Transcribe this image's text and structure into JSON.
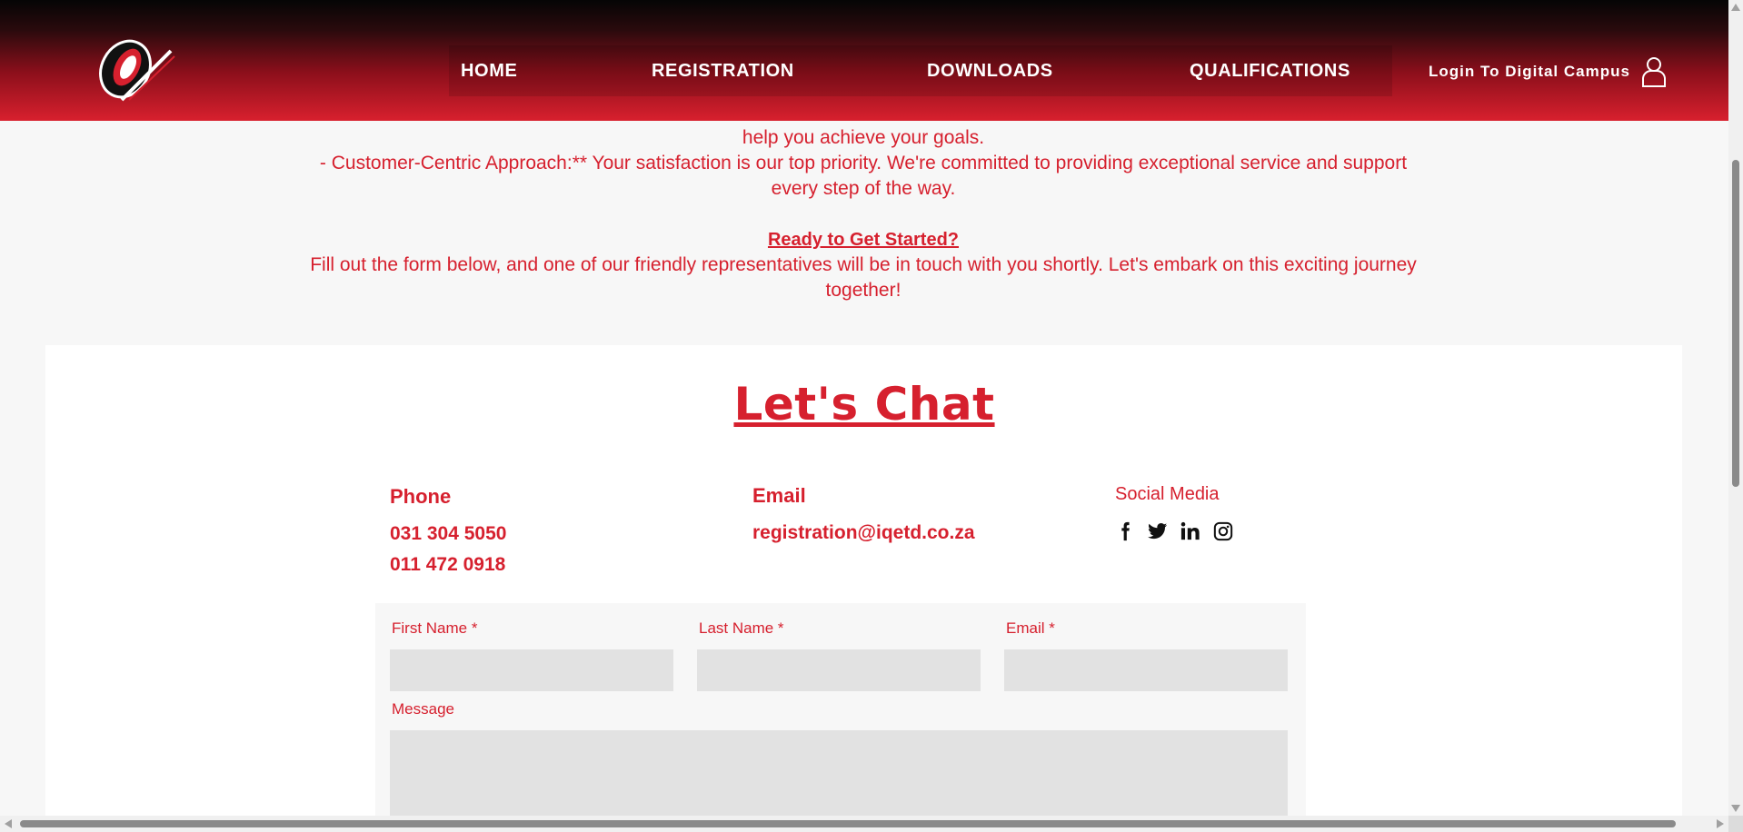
{
  "header": {
    "nav": [
      {
        "label": "HOME"
      },
      {
        "label": "REGISTRATION"
      },
      {
        "label": "DOWNLOADS"
      },
      {
        "label": "QUALIFICATIONS"
      }
    ],
    "login_label": "Login To Digital Campus"
  },
  "intro": {
    "partial_line": "help you achieve your goals.",
    "customer_line": "- Customer-Centric Approach:** Your satisfaction is our top priority. We're committed to providing exceptional service and support every step of the way.",
    "ready_heading": "Ready to Get Started?",
    "ready_text": "Fill out the form below, and one of our friendly representatives will be in touch with you shortly. Let's embark on this exciting journey together!"
  },
  "contact": {
    "title": "Let's Chat",
    "phone_label": "Phone",
    "phone_1": "031 304 5050",
    "phone_2": "011 472 0918",
    "email_label": "Email",
    "email_value": "registration@iqetd.co.za",
    "social_label": "Social Media",
    "social_icons": [
      "facebook-icon",
      "twitter-icon",
      "linkedin-icon",
      "instagram-icon"
    ]
  },
  "form": {
    "first_name_label": "First Name *",
    "last_name_label": "Last Name *",
    "email_label": "Email *",
    "message_label": "Message",
    "first_name_value": "",
    "last_name_value": "",
    "email_value": "",
    "message_value": ""
  },
  "colors": {
    "brand_red": "#d6202e",
    "header_dark": "#050505",
    "input_bg": "#e2e2e2"
  }
}
